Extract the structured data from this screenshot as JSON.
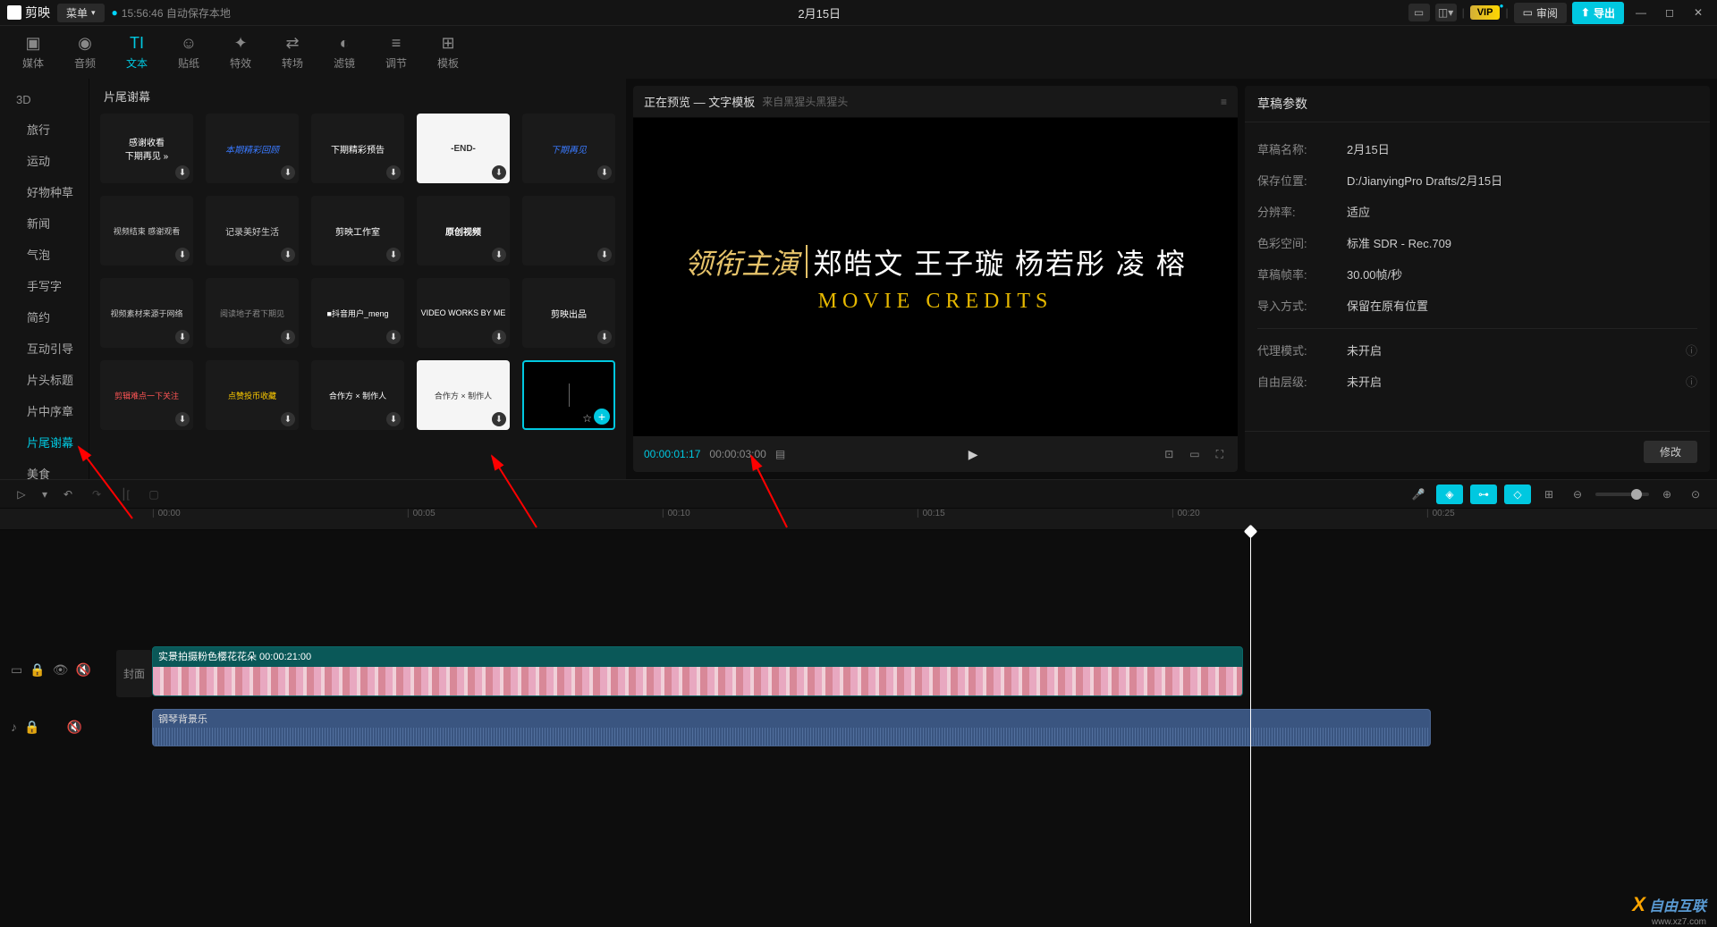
{
  "titlebar": {
    "app_name": "剪映",
    "menu_label": "菜单",
    "autosave_text": "15:56:46 自动保存本地",
    "project_title": "2月15日",
    "vip_label": "VIP",
    "review_label": "审阅",
    "export_label": "导出"
  },
  "tool_tabs": [
    {
      "icon": "▣",
      "label": "媒体"
    },
    {
      "icon": "◉",
      "label": "音频"
    },
    {
      "icon": "TI",
      "label": "文本"
    },
    {
      "icon": "☺",
      "label": "贴纸"
    },
    {
      "icon": "✦",
      "label": "特效"
    },
    {
      "icon": "⇄",
      "label": "转场"
    },
    {
      "icon": "◐",
      "label": "滤镜"
    },
    {
      "icon": "≡",
      "label": "调节"
    },
    {
      "icon": "⊞",
      "label": "模板"
    }
  ],
  "category_extra": "3D",
  "categories": [
    "旅行",
    "运动",
    "好物种草",
    "新闻",
    "气泡",
    "手写字",
    "简约",
    "互动引导",
    "片头标题",
    "片中序章",
    "片尾谢幕",
    "美食"
  ],
  "active_category": "片尾谢幕",
  "template_section_title": "片尾谢幕",
  "templates": [
    {
      "text": "感谢收看\n下期再见 »",
      "style": "bg:#1a1a1a;color:#fff"
    },
    {
      "text": "本期精彩回顾",
      "style": "bg:#1a1a1a;color:#3a7aff;font-style:italic"
    },
    {
      "text": "下期精彩预告",
      "style": "bg:#1a1a1a;color:#fff"
    },
    {
      "text": "-END-",
      "style": "bg:#f5f5f5;color:#333;font-weight:bold"
    },
    {
      "text": "下期再见",
      "style": "bg:#1a1a1a;color:#3a7aff;font-style:italic"
    },
    {
      "text": "视频结束 感谢观看",
      "style": "bg:#1a1a1a;color:#ccc;font-size:9px"
    },
    {
      "text": "记录美好生活",
      "style": "bg:#1a1a1a;color:#ccc;font-family:cursive"
    },
    {
      "text": "剪映工作室",
      "style": "bg:#1a1a1a;color:#fff"
    },
    {
      "text": "原创视频",
      "style": "bg:#1a1a1a;color:#fff;font-weight:bold"
    },
    {
      "text": "",
      "style": "bg:#1a1a1a"
    },
    {
      "text": "视频素材来源于网络",
      "style": "bg:#1a1a1a;color:#ccc;font-size:9px"
    },
    {
      "text": "阅读地子君下期见",
      "style": "bg:#1a1a1a;color:#888;font-size:9px"
    },
    {
      "text": "■抖音用户_meng",
      "style": "bg:#1a1a1a;color:#fff;font-size:9px"
    },
    {
      "text": "VIDEO WORKS BY ME",
      "style": "bg:#1a1a1a;color:#fff;font-size:9px"
    },
    {
      "text": "剪映出品",
      "style": "bg:#1a1a1a;color:#fff"
    },
    {
      "text": "剪辑难点一下关注",
      "style": "bg:#1a1a1a;color:#f55;font-size:9px"
    },
    {
      "text": "点赞投币收藏",
      "style": "bg:#1a1a1a;color:#ffcc00;font-size:9px"
    },
    {
      "text": "合作方 × 制作人",
      "style": "bg:#1a1a1a;color:#fff;font-size:9px"
    },
    {
      "text": "合作方 × 制作人",
      "style": "bg:#f5f5f5;color:#333;font-size:9px"
    },
    {
      "text": "",
      "style": "bg:#000",
      "selected": true
    }
  ],
  "preview": {
    "header_main": "正在预览 — 文字模板",
    "header_sub": "来自黑猩头黑猩头",
    "credit_lead": "领衔主演",
    "credit_names": "郑皓文 王子璇 杨若彤 凌 榕",
    "credit_sub": "MOVIE CREDITS",
    "time_current": "00:00:01:17",
    "time_total": "00:00:03:00"
  },
  "props": {
    "panel_title": "草稿参数",
    "rows": [
      {
        "label": "草稿名称:",
        "value": "2月15日"
      },
      {
        "label": "保存位置:",
        "value": "D:/JianyingPro Drafts/2月15日"
      },
      {
        "label": "分辨率:",
        "value": "适应"
      },
      {
        "label": "色彩空间:",
        "value": "标准 SDR - Rec.709"
      },
      {
        "label": "草稿帧率:",
        "value": "30.00帧/秒"
      },
      {
        "label": "导入方式:",
        "value": "保留在原有位置"
      },
      {
        "label": "代理模式:",
        "value": "未开启",
        "info": true
      },
      {
        "label": "自由层级:",
        "value": "未开启",
        "info": true
      }
    ],
    "modify_btn": "修改"
  },
  "timeline": {
    "ruler_ticks": [
      "00:00",
      "00:05",
      "00:10",
      "00:15",
      "00:20",
      "00:25"
    ],
    "video_clip_label": "实景拍摄粉色樱花花朵  00:00:21:00",
    "audio_clip_label": "钢琴背景乐",
    "cover_label": "封面"
  },
  "watermark": {
    "main": "自由互联",
    "sub": "www.xz7.com"
  }
}
